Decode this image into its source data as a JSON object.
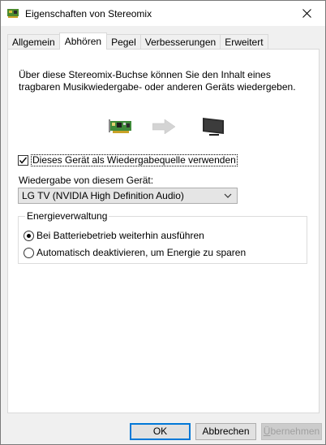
{
  "window": {
    "title": "Eigenschaften von Stereomix",
    "close_icon": "close-icon"
  },
  "tabs": [
    {
      "label": "Allgemein",
      "active": false
    },
    {
      "label": "Abhören",
      "active": true
    },
    {
      "label": "Pegel",
      "active": false
    },
    {
      "label": "Verbesserungen",
      "active": false
    },
    {
      "label": "Erweitert",
      "active": false
    }
  ],
  "listen": {
    "description": "Über diese Stereomix-Buchse können Sie den Inhalt eines tragbaren Musikwiedergabe- oder anderen Geräts wiedergeben.",
    "flow_icons": [
      "sound-card-icon",
      "arrow-right-icon",
      "tv-monitor-icon"
    ],
    "checkbox_label": "Dieses Gerät als Wiedergabequelle verwenden",
    "checkbox_checked": true,
    "playback_label": "Wiedergabe von diesem Gerät:",
    "playback_value": "LG TV (NVIDIA High Definition Audio)"
  },
  "power": {
    "title": "Energieverwaltung",
    "options": [
      {
        "label": "Bei Batteriebetrieb weiterhin ausführen",
        "checked": true
      },
      {
        "label": "Automatisch deaktivieren, um Energie zu sparen",
        "checked": false
      }
    ]
  },
  "buttons": {
    "ok": "OK",
    "cancel": "Abbrechen",
    "apply_first": "Ü",
    "apply_rest": "bernehmen"
  },
  "colors": {
    "accent": "#0078d7",
    "window_bg": "#f0f0f0",
    "panel_bg": "#ffffff"
  }
}
